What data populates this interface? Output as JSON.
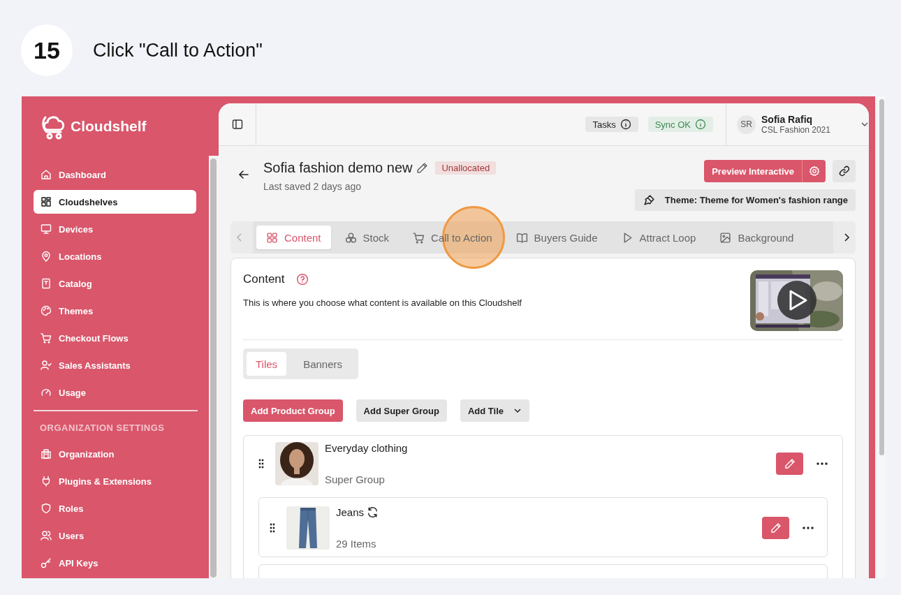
{
  "step": {
    "number": "15",
    "instruction": "Click \"Call to Action\""
  },
  "brand": "Cloudshelf",
  "sidebar": {
    "items": [
      {
        "label": "Dashboard",
        "selected": false
      },
      {
        "label": "Cloudshelves",
        "selected": true
      },
      {
        "label": "Devices",
        "selected": false
      },
      {
        "label": "Locations",
        "selected": false
      },
      {
        "label": "Catalog",
        "selected": false
      },
      {
        "label": "Themes",
        "selected": false
      },
      {
        "label": "Checkout Flows",
        "selected": false
      },
      {
        "label": "Sales Assistants",
        "selected": false
      },
      {
        "label": "Usage",
        "selected": false
      }
    ],
    "section_title": "ORGANIZATION SETTINGS",
    "settings_items": [
      {
        "label": "Organization",
        "selected": false
      },
      {
        "label": "Plugins & Extensions",
        "selected": false
      },
      {
        "label": "Roles",
        "selected": false
      },
      {
        "label": "Users",
        "selected": false
      },
      {
        "label": "API Keys",
        "selected": false
      }
    ]
  },
  "topbar": {
    "tasks": "Tasks",
    "sync": "Sync OK",
    "user": {
      "initials": "SR",
      "name": "Sofia Rafiq",
      "org": "CSL Fashion 2021"
    }
  },
  "page": {
    "title": "Sofia fashion demo new",
    "status": "Unallocated",
    "subtitle": "Last saved 2 days ago",
    "preview_button": "Preview Interactive",
    "theme": "Theme: Theme for Women's fashion range"
  },
  "tabs": [
    {
      "label": "Content",
      "selected": true,
      "highlighted": false
    },
    {
      "label": "Stock",
      "selected": false,
      "highlighted": false
    },
    {
      "label": "Call to Action",
      "selected": false,
      "highlighted": true
    },
    {
      "label": "Buyers Guide",
      "selected": false,
      "highlighted": false
    },
    {
      "label": "Attract Loop",
      "selected": false,
      "highlighted": false
    },
    {
      "label": "Background",
      "selected": false,
      "highlighted": false
    }
  ],
  "content": {
    "title": "Content",
    "description": "This is where you choose what content is available on this Cloudshelf",
    "subtabs": [
      {
        "label": "Tiles",
        "selected": true
      },
      {
        "label": "Banners",
        "selected": false
      }
    ],
    "buttons": [
      {
        "label": "Add Product Group",
        "kind": "primary"
      },
      {
        "label": "Add Super Group",
        "kind": "secondary"
      },
      {
        "label": "Add Tile",
        "kind": "dropdown"
      }
    ],
    "groups": [
      {
        "title": "Everyday clothing",
        "subtitle": "Super Group",
        "synced": false,
        "kind": "person",
        "children": [
          {
            "title": "Jeans",
            "subtitle": "29 Items",
            "synced": true,
            "kind": "jeans"
          }
        ]
      }
    ]
  }
}
